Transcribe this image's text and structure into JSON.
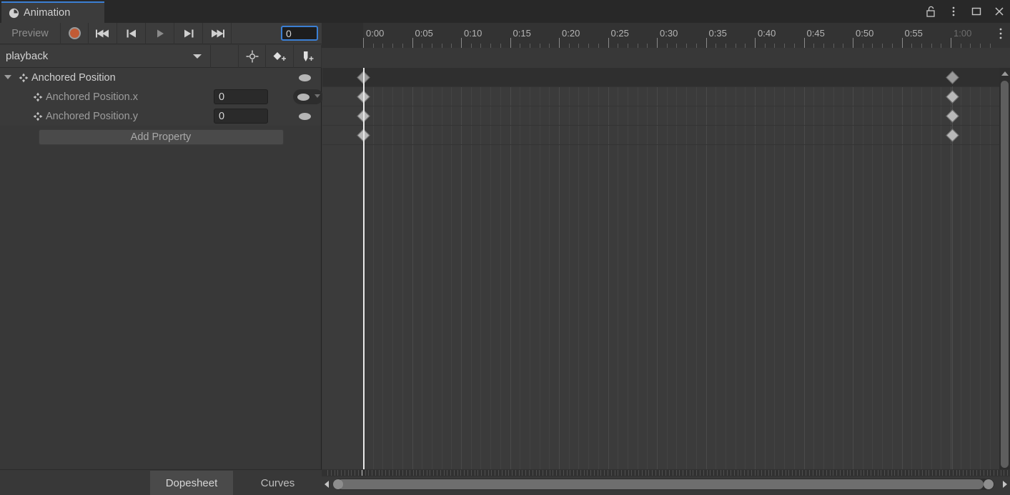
{
  "window": {
    "tab_title": "Animation",
    "tab_icon": "clock-icon",
    "controls": [
      {
        "name": "lock-icon",
        "glyph": "unlock"
      },
      {
        "name": "kebab-menu-icon",
        "glyph": "kebab"
      },
      {
        "name": "maximize-icon",
        "glyph": "square"
      },
      {
        "name": "close-icon",
        "glyph": "x"
      }
    ]
  },
  "toolbar": {
    "preview_label": "Preview",
    "record_button": "record-button",
    "first_frame_button": "first-frame-button",
    "prev_frame_button": "previous-frame-button",
    "play_button": "play-button",
    "next_frame_button": "next-frame-button",
    "last_frame_button": "last-frame-button",
    "frame_value": "0",
    "clip_name": "playback",
    "filter_button": "filter-by-selection-button",
    "add_keyframe_button": "add-keyframe-button",
    "add_event_button": "add-event-button"
  },
  "properties": {
    "rows": [
      {
        "label": "Anchored Position",
        "value": null,
        "level": 0,
        "expanded": true,
        "highlighted": false
      },
      {
        "label": "Anchored Position.x",
        "value": "0",
        "level": 1,
        "expanded": false,
        "highlighted": true
      },
      {
        "label": "Anchored Position.y",
        "value": "0",
        "level": 1,
        "expanded": false,
        "highlighted": false
      }
    ],
    "add_property_label": "Add Property"
  },
  "timeline": {
    "labels": [
      "0:00",
      "0:05",
      "0:10",
      "0:15",
      "0:20",
      "0:25",
      "0:30",
      "0:35",
      "0:40",
      "0:45",
      "0:50",
      "0:55",
      "1:00"
    ],
    "dim_labels": [
      "1:00"
    ],
    "playhead_time": "0:00",
    "keyframe_times": [
      "0:00",
      "0:57"
    ],
    "keyframe_rows": 4
  },
  "bottom": {
    "tabs": [
      {
        "label": "Dopesheet",
        "active": true
      },
      {
        "label": "Curves",
        "active": false
      }
    ]
  }
}
